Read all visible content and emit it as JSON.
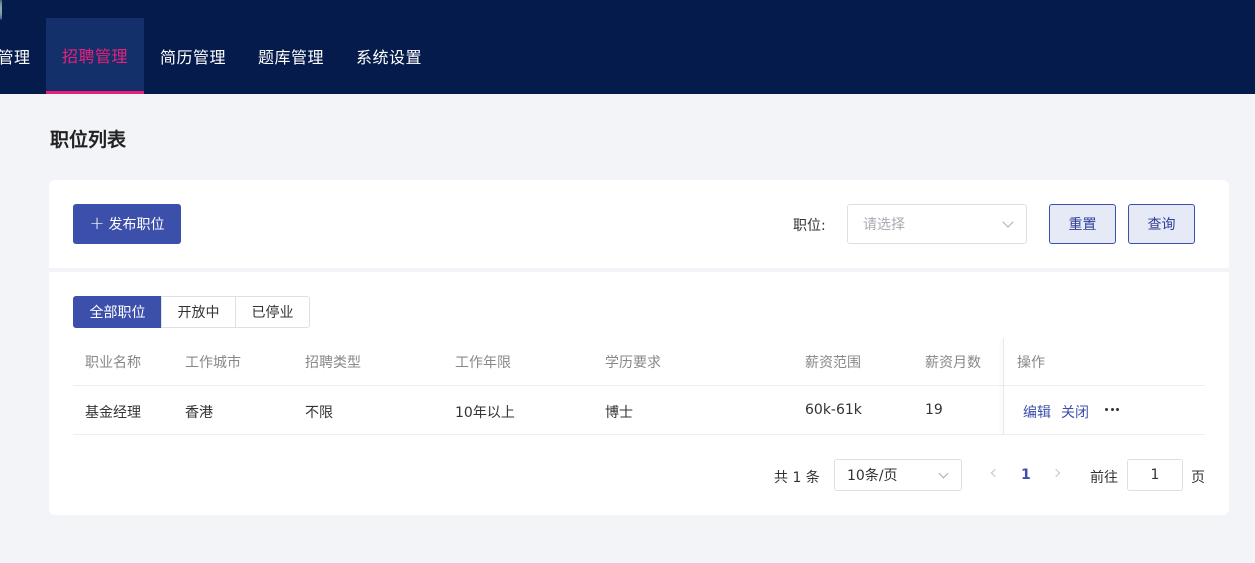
{
  "nav": {
    "items": [
      {
        "label": "管理"
      },
      {
        "label": "招聘管理"
      },
      {
        "label": "简历管理"
      },
      {
        "label": "题库管理"
      },
      {
        "label": "系统设置"
      }
    ],
    "active_index": 1
  },
  "page": {
    "title": "职位列表"
  },
  "filter": {
    "publish_label": "发布职位",
    "position_label": "职位:",
    "position_placeholder": "请选择",
    "reset_label": "重置",
    "query_label": "查询"
  },
  "tabs": [
    {
      "label": "全部职位"
    },
    {
      "label": "开放中"
    },
    {
      "label": "已停业"
    }
  ],
  "table": {
    "columns": [
      "职业名称",
      "工作城市",
      "招聘类型",
      "工作年限",
      "学历要求",
      "薪资范围",
      "薪资月数",
      "操作"
    ],
    "rows": [
      {
        "cells": [
          "基金经理",
          "香港",
          "不限",
          "10年以上",
          "博士",
          "60k-61k",
          "19"
        ],
        "actions": {
          "edit": "编辑",
          "close": "关闭"
        }
      }
    ]
  },
  "pagination": {
    "total_text": "共 1 条",
    "page_size": "10条/页",
    "current_page": "1",
    "goto_label": "前往",
    "goto_value": "1",
    "page_suffix": "页"
  },
  "colors": {
    "nav_bg": "#051b4b",
    "active_nav_text": "#e8207a",
    "primary": "#3c4fab"
  }
}
